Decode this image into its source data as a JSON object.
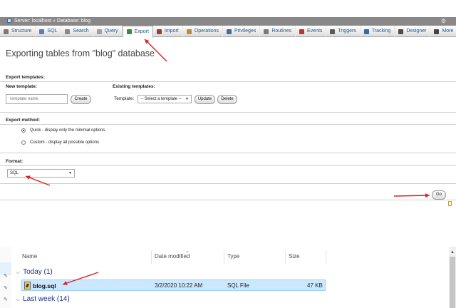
{
  "pma": {
    "breadcrumb": "Server: localhost » Database: blog",
    "tabs": [
      {
        "label": "Structure",
        "icon": "structure-icon",
        "color": "#7a7a7a"
      },
      {
        "label": "SQL",
        "icon": "sql-icon",
        "color": "#5a7fb0"
      },
      {
        "label": "Search",
        "icon": "search-icon",
        "color": "#888888"
      },
      {
        "label": "Query",
        "icon": "query-icon",
        "color": "#a0a0a0"
      },
      {
        "label": "Export",
        "icon": "export-icon",
        "color": "#3a8a3a",
        "active": true
      },
      {
        "label": "Import",
        "icon": "import-icon",
        "color": "#a03a3a"
      },
      {
        "label": "Operations",
        "icon": "operations-icon",
        "color": "#c08a2a"
      },
      {
        "label": "Privileges",
        "icon": "privileges-icon",
        "color": "#4a6a9a"
      },
      {
        "label": "Routines",
        "icon": "routines-icon",
        "color": "#7a7a7a"
      },
      {
        "label": "Events",
        "icon": "events-icon",
        "color": "#c03030"
      },
      {
        "label": "Triggers",
        "icon": "triggers-icon",
        "color": "#5a5a5a"
      },
      {
        "label": "Tracking",
        "icon": "tracking-icon",
        "color": "#3a6a9a"
      },
      {
        "label": "Designer",
        "icon": "designer-icon",
        "color": "#4a4a4a"
      },
      {
        "label": "More",
        "icon": "more-icon",
        "color": "#444444"
      }
    ],
    "title": "Exporting tables from \"blog\" database",
    "export_templates": {
      "heading": "Export templates:",
      "new_template_label": "New template:",
      "template_name_placeholder": "Template name",
      "create_button": "Create",
      "existing_templates_label": "Existing templates:",
      "template_label": "Template:",
      "template_select": "-- Select a template --",
      "update_button": "Update",
      "delete_button": "Delete"
    },
    "export_method": {
      "heading": "Export method:",
      "options": [
        {
          "label": "Quick - display only the minimal options",
          "checked": true
        },
        {
          "label": "Custom - display all possible options",
          "checked": false
        }
      ]
    },
    "format": {
      "heading": "Format:",
      "selected": "SQL"
    },
    "go_button": "Go"
  },
  "explorer": {
    "columns": {
      "name": "Name",
      "date_modified": "Date modified",
      "type": "Type",
      "size": "Size"
    },
    "groups": [
      {
        "label": "Today (1)"
      },
      {
        "label": "Last week (14)"
      }
    ],
    "file": {
      "name": "blog.sql",
      "date_modified": "3/2/2020 10:22 AM",
      "type": "SQL File",
      "size": "47 KB"
    }
  },
  "colors": {
    "annotation_arrow": "#e02020",
    "selection": "#cce8ff",
    "tab_link": "#235a81",
    "group_header": "#1e3287"
  }
}
